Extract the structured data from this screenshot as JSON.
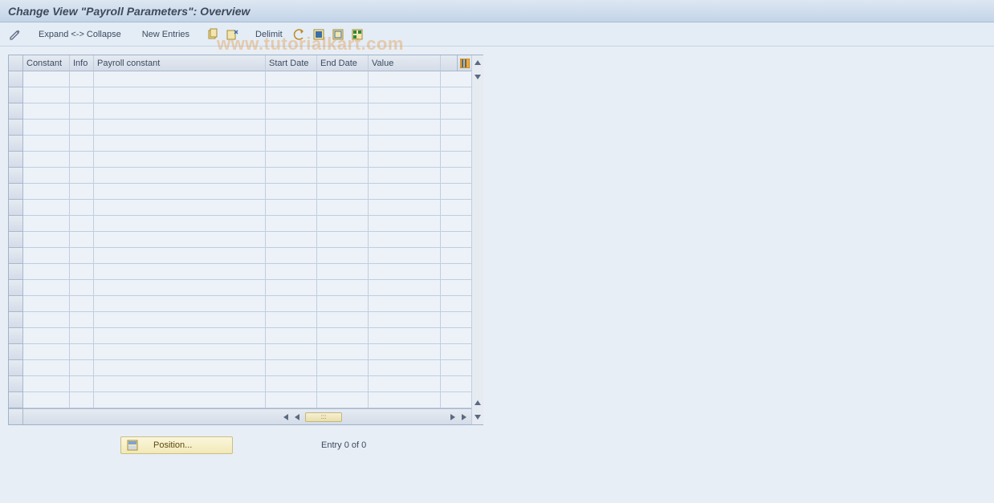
{
  "title": "Change View \"Payroll Parameters\": Overview",
  "watermark": "www.tutorialkart.com",
  "toolbar": {
    "expand_collapse": "Expand <-> Collapse",
    "new_entries": "New Entries",
    "delimit": "Delimit"
  },
  "table": {
    "columns": {
      "constant": "Constant",
      "info": "Info",
      "payroll": "Payroll constant",
      "start": "Start Date",
      "end": "End Date",
      "value": "Value"
    },
    "row_count": 21
  },
  "footer": {
    "position_label": "Position...",
    "entry_text": "Entry 0 of 0"
  }
}
